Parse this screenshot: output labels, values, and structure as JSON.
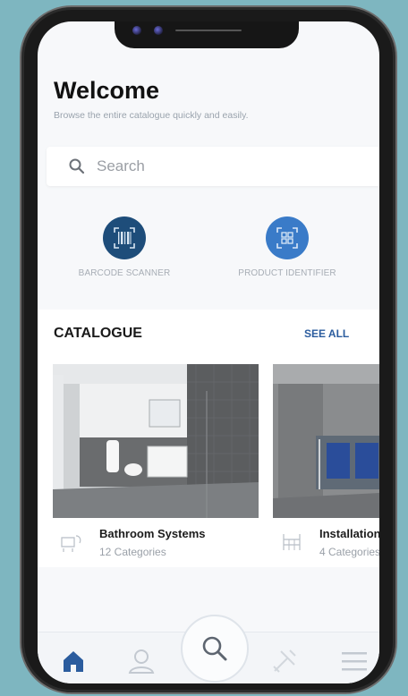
{
  "header": {
    "title": "Welcome",
    "subtitle": "Browse the entire catalogue quickly and easily."
  },
  "search": {
    "placeholder": "Search"
  },
  "tools": [
    {
      "label": "BARCODE SCANNER",
      "icon": "barcode-scanner-icon",
      "color": "#1e4d7a"
    },
    {
      "label": "PRODUCT IDENTIFIER",
      "icon": "product-identifier-icon",
      "color": "#3a7bc8"
    }
  ],
  "catalogue": {
    "title": "CATALOGUE",
    "see_all_label": "SEE ALL",
    "items": [
      {
        "title": "Bathroom Systems",
        "count": "12 Categories",
        "icon": "bathroom-systems-icon"
      },
      {
        "title": "Installation",
        "count": "4 Categories",
        "icon": "installation-systems-icon"
      }
    ]
  },
  "nav": {
    "items": [
      "home-icon",
      "profile-icon",
      "search-icon",
      "tools-icon",
      "menu-icon"
    ],
    "active_color": "#2b5c9e",
    "inactive_color": "#c3c9d1"
  }
}
